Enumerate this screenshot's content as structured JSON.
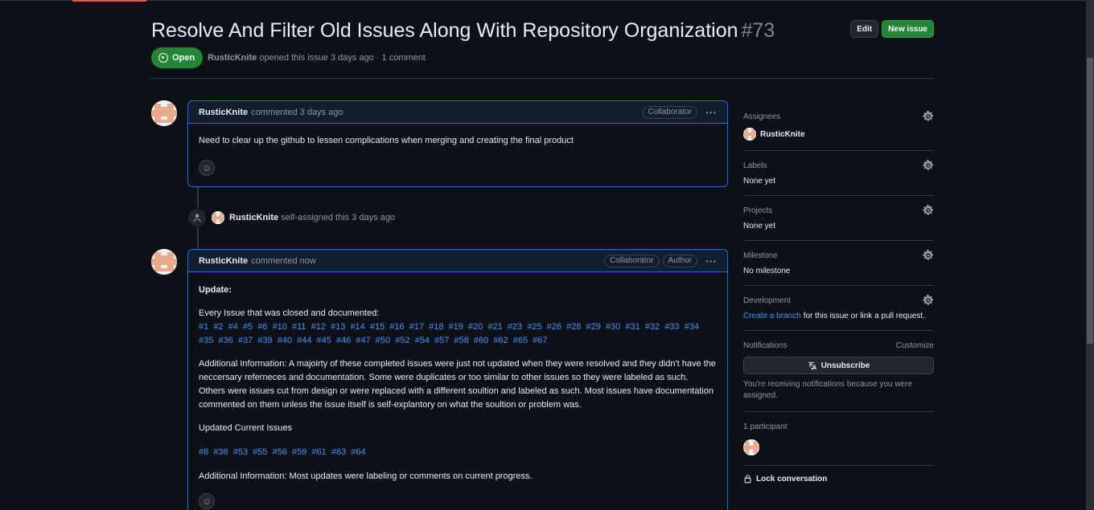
{
  "colors": {
    "accent_blue": "#4493f8",
    "open_green": "#238636",
    "border_blue": "#1f6feb",
    "background": "#0d1117"
  },
  "header": {
    "title": "Resolve And Filter Old Issues Along With Repository Organization",
    "number": "#73",
    "edit_label": "Edit",
    "new_issue_label": "New issue"
  },
  "meta": {
    "state": "Open",
    "author": "RusticKnite",
    "text": "opened this issue 3 days ago · 1 comment"
  },
  "comment1": {
    "author": "RusticKnite",
    "action": "commented 3 days ago",
    "badge": "Collaborator",
    "body": "Need to clear up the github to lessen complications when merging and creating the final product"
  },
  "event": {
    "author": "RusticKnite",
    "text": "self-assigned this 3 days ago"
  },
  "comment2": {
    "author": "RusticKnite",
    "action": "commented now",
    "badge1": "Collaborator",
    "badge2": "Author",
    "update_heading": "Update:",
    "closed_intro": "Every Issue that was closed and documented:",
    "closed_issues": [
      "#1",
      "#2",
      "#4",
      "#5",
      "#6",
      "#10",
      "#11",
      "#12",
      "#13",
      "#14",
      "#15",
      "#16",
      "#17",
      "#18",
      "#19",
      "#20",
      "#21",
      "#23",
      "#25",
      "#26",
      "#28",
      "#29",
      "#30",
      "#31",
      "#32",
      "#33",
      "#34",
      "#35",
      "#36",
      "#37",
      "#39",
      "#40",
      "#44",
      "#45",
      "#46",
      "#47",
      "#50",
      "#52",
      "#54",
      "#57",
      "#58",
      "#60",
      "#62",
      "#65",
      "#67"
    ],
    "additional_info_1": "Additional Information: A majoirty of these completed issues were just not updated when they were resolved and they didn't have the neccersary referneces and documentation. Some were duplicates or too similar to other issues so they were labeled as such. Others were issues cut from design or were replaced with a different soultion and labeled as such. Most issues have documentation commented on them unless the issue itself is self-explantory on what the soultion or problem was.",
    "current_heading": "Updated Current Issues",
    "current_issues": [
      "#8",
      "#38",
      "#53",
      "#55",
      "#56",
      "#59",
      "#61",
      "#63",
      "#64"
    ],
    "additional_info_2": "Additional Information: Most updates were labeling or comments on current progress."
  },
  "sidebar": {
    "assignees_label": "Assignees",
    "assignee": "RusticKnite",
    "labels_label": "Labels",
    "labels_value": "None yet",
    "projects_label": "Projects",
    "projects_value": "None yet",
    "milestone_label": "Milestone",
    "milestone_value": "No milestone",
    "development_label": "Development",
    "create_branch": "Create a branch",
    "development_rest": "for this issue or link a pull request.",
    "notifications_label": "Notifications",
    "customize": "Customize",
    "unsubscribe": "Unsubscribe",
    "notification_reason": "You're receiving notifications because you were assigned.",
    "participants": "1 participant",
    "lock": "Lock conversation"
  }
}
